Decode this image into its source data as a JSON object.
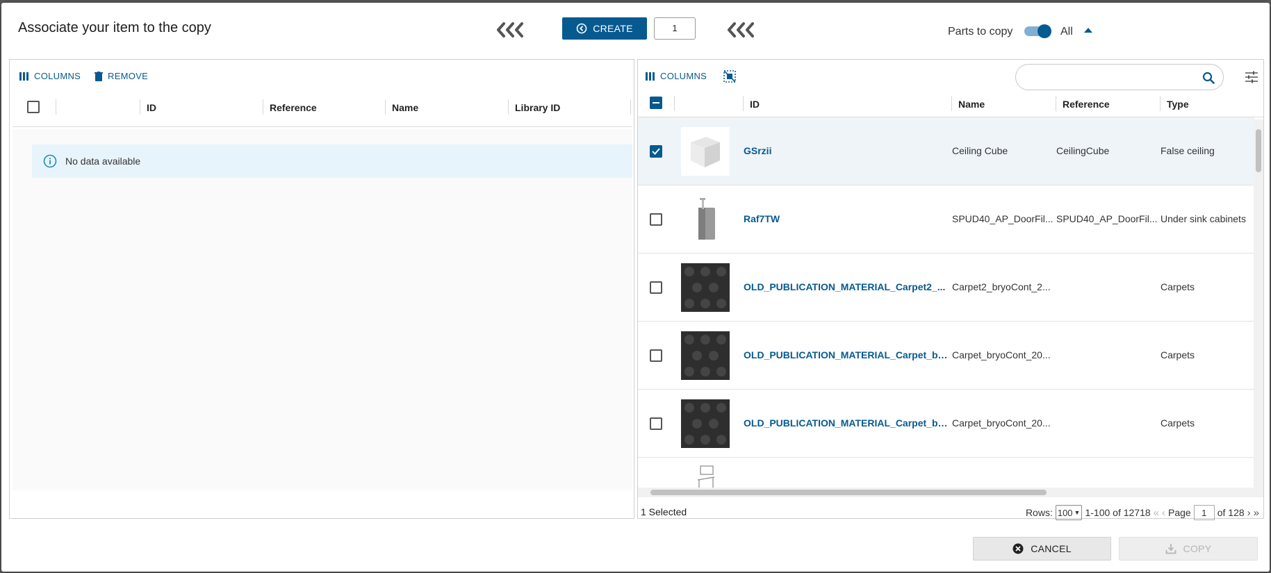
{
  "dialog": {
    "title": "Associate your item to the copy",
    "create_label": "CREATE",
    "quantity": "1",
    "parts_label": "Parts to copy",
    "parts_value": "All",
    "parts_toggle_on": true
  },
  "left_panel": {
    "toolbar": {
      "columns_label": "COLUMNS",
      "remove_label": "REMOVE"
    },
    "headers": [
      "ID",
      "Reference",
      "Name",
      "Library ID"
    ],
    "empty_message": "No data available"
  },
  "right_panel": {
    "toolbar": {
      "columns_label": "COLUMNS"
    },
    "search": {
      "placeholder": ""
    },
    "headers": [
      "ID",
      "Name",
      "Reference",
      "Type"
    ],
    "rows": [
      {
        "id": "GSrzii",
        "name": "Ceiling Cube",
        "reference": "CeilingCube",
        "type": "False ceiling",
        "selected": true,
        "thumb": "cube"
      },
      {
        "id": "Raf7TW",
        "name": "SPUD40_AP_DoorFil...",
        "reference": "SPUD40_AP_DoorFil...",
        "type": "Under sink cabinets",
        "selected": false,
        "thumb": "cabinet"
      },
      {
        "id": "OLD_PUBLICATION_MATERIAL_Carpet2_...",
        "name": "Carpet2_bryoCont_2...",
        "reference": "",
        "type": "Carpets",
        "selected": false,
        "thumb": "carpet"
      },
      {
        "id": "OLD_PUBLICATION_MATERIAL_Carpet_br...",
        "name": "Carpet_bryoCont_20...",
        "reference": "",
        "type": "Carpets",
        "selected": false,
        "thumb": "carpet"
      },
      {
        "id": "OLD_PUBLICATION_MATERIAL_Carpet_br...",
        "name": "Carpet_bryoCont_20...",
        "reference": "",
        "type": "Carpets",
        "selected": false,
        "thumb": "carpet"
      }
    ],
    "footer": {
      "selected_text": "1 Selected",
      "rows_label": "Rows:",
      "rows_per_page": "100",
      "range_text": "1-100 of 12718",
      "page_label": "Page",
      "page_number": "1",
      "page_total": "of 128"
    }
  },
  "actions": {
    "cancel_label": "CANCEL",
    "copy_label": "COPY"
  },
  "colors": {
    "accent": "#075a90",
    "selected_row": "#eef4f8",
    "info_bg": "#e8f4fb"
  }
}
